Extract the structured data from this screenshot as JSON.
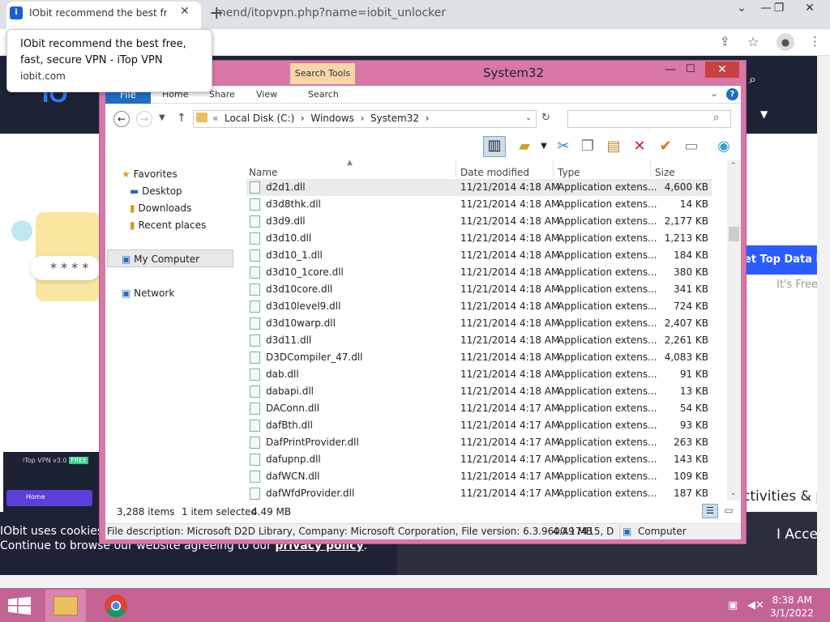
{
  "browser": {
    "tab_title": "IObit recommend the best free, f",
    "url": "iobit.com/en/recommend/itopvpn.php?name=iobit_unlocker",
    "url_visible": "mend/itopvpn.php?name=iobit_unlocker",
    "tooltip_title": "IObit recommend the best free, fast, secure VPN - iTop VPN",
    "tooltip_domain": "iobit.com"
  },
  "page": {
    "cta": "et Top Data Pr",
    "free": "It's Free",
    "promo_title": "iTop VPN v3.0",
    "promo_badge": "FREE",
    "promo_home": "Home",
    "activities": "ctivities & p",
    "cookie_line1": "IObit uses cookies t",
    "cookie_line2": "Continue to browse our website agreeing to our",
    "cookie_link": "privacy policy",
    "accept": "I Accep",
    "password_mask": "* * * *"
  },
  "explorer": {
    "title": "System32",
    "search_tools": "Search Tools",
    "ribbon_tabs": [
      "File",
      "Home",
      "Share",
      "View",
      "Search"
    ],
    "breadcrumb": [
      "Local Disk (C:)",
      "Windows",
      "System32"
    ],
    "nav": {
      "favorites": "Favorites",
      "desktop": "Desktop",
      "downloads": "Downloads",
      "recent": "Recent places",
      "computer": "My Computer",
      "network": "Network"
    },
    "columns": [
      "Name",
      "Date modified",
      "Type",
      "Size"
    ],
    "files": [
      {
        "name": "d2d1.dll",
        "date": "11/21/2014 4:18 AM",
        "type": "Application extens...",
        "size": "4,600 KB"
      },
      {
        "name": "d3d8thk.dll",
        "date": "11/21/2014 4:18 AM",
        "type": "Application extens...",
        "size": "14 KB"
      },
      {
        "name": "d3d9.dll",
        "date": "11/21/2014 4:18 AM",
        "type": "Application extens...",
        "size": "2,177 KB"
      },
      {
        "name": "d3d10.dll",
        "date": "11/21/2014 4:18 AM",
        "type": "Application extens...",
        "size": "1,213 KB"
      },
      {
        "name": "d3d10_1.dll",
        "date": "11/21/2014 4:18 AM",
        "type": "Application extens...",
        "size": "184 KB"
      },
      {
        "name": "d3d10_1core.dll",
        "date": "11/21/2014 4:18 AM",
        "type": "Application extens...",
        "size": "380 KB"
      },
      {
        "name": "d3d10core.dll",
        "date": "11/21/2014 4:18 AM",
        "type": "Application extens...",
        "size": "341 KB"
      },
      {
        "name": "d3d10level9.dll",
        "date": "11/21/2014 4:18 AM",
        "type": "Application extens...",
        "size": "724 KB"
      },
      {
        "name": "d3d10warp.dll",
        "date": "11/21/2014 4:18 AM",
        "type": "Application extens...",
        "size": "2,407 KB"
      },
      {
        "name": "d3d11.dll",
        "date": "11/21/2014 4:18 AM",
        "type": "Application extens...",
        "size": "2,261 KB"
      },
      {
        "name": "D3DCompiler_47.dll",
        "date": "11/21/2014 4:18 AM",
        "type": "Application extens...",
        "size": "4,083 KB"
      },
      {
        "name": "dab.dll",
        "date": "11/21/2014 4:18 AM",
        "type": "Application extens...",
        "size": "91 KB"
      },
      {
        "name": "dabapi.dll",
        "date": "11/21/2014 4:18 AM",
        "type": "Application extens...",
        "size": "13 KB"
      },
      {
        "name": "DAConn.dll",
        "date": "11/21/2014 4:17 AM",
        "type": "Application extens...",
        "size": "54 KB"
      },
      {
        "name": "dafBth.dll",
        "date": "11/21/2014 4:17 AM",
        "type": "Application extens...",
        "size": "93 KB"
      },
      {
        "name": "DafPrintProvider.dll",
        "date": "11/21/2014 4:17 AM",
        "type": "Application extens...",
        "size": "263 KB"
      },
      {
        "name": "dafupnp.dll",
        "date": "11/21/2014 4:17 AM",
        "type": "Application extens...",
        "size": "143 KB"
      },
      {
        "name": "dafWCN.dll",
        "date": "11/21/2014 4:17 AM",
        "type": "Application extens...",
        "size": "109 KB"
      },
      {
        "name": "dafWfdProvider.dll",
        "date": "11/21/2014 4:17 AM",
        "type": "Application extens...",
        "size": "187 KB"
      }
    ],
    "status": {
      "items": "3,288 items",
      "selected": "1 item selected",
      "size": "4.49 MB"
    },
    "description": "File description: Microsoft D2D Library, Company: Microsoft Corporation, File version: 6.3.9600.17415, D",
    "description_size": "4.49 MB",
    "description_location": "Computer"
  },
  "taskbar": {
    "time": "8:38 AM",
    "date": "3/1/2022"
  },
  "colors": {
    "window_frame": "#d878a8",
    "taskbar": "#c36494",
    "accent": "#1f6cc4"
  }
}
